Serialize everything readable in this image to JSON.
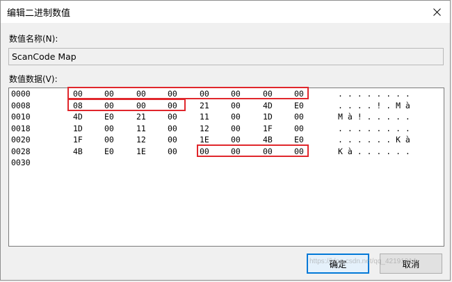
{
  "window": {
    "title": "编辑二进制数值",
    "close_symbol": "✕"
  },
  "value_name": {
    "label": "数值名称(N):",
    "value": "ScanCode Map"
  },
  "value_data": {
    "label": "数值数据(V):",
    "rows": [
      {
        "addr": "0000",
        "bytes": [
          "00",
          "00",
          "00",
          "00",
          "00",
          "00",
          "00",
          "00"
        ],
        "ascii": ". . . . . . . ."
      },
      {
        "addr": "0008",
        "bytes": [
          "08",
          "00",
          "00",
          "00",
          "21",
          "00",
          "4D",
          "E0"
        ],
        "ascii": ". . . . ! . M à"
      },
      {
        "addr": "0010",
        "bytes": [
          "4D",
          "E0",
          "21",
          "00",
          "11",
          "00",
          "1D",
          "00"
        ],
        "ascii": "M à ! . . . . ."
      },
      {
        "addr": "0018",
        "bytes": [
          "1D",
          "00",
          "11",
          "00",
          "12",
          "00",
          "1F",
          "00"
        ],
        "ascii": ". . . . . . . ."
      },
      {
        "addr": "0020",
        "bytes": [
          "1F",
          "00",
          "12",
          "00",
          "1E",
          "00",
          "4B",
          "E0"
        ],
        "ascii": ". . . . . . K à"
      },
      {
        "addr": "0028",
        "bytes": [
          "4B",
          "E0",
          "1E",
          "00",
          "00",
          "00",
          "00",
          "00"
        ],
        "ascii": "K à . . . . . ."
      },
      {
        "addr": "0030",
        "bytes": [],
        "ascii": ""
      }
    ]
  },
  "buttons": {
    "ok": "确定",
    "cancel": "取消"
  },
  "colors": {
    "highlight": "#e0262b",
    "accent": "#0078d7"
  },
  "watermark": "https://blog.csdn.net/qq_42191914"
}
